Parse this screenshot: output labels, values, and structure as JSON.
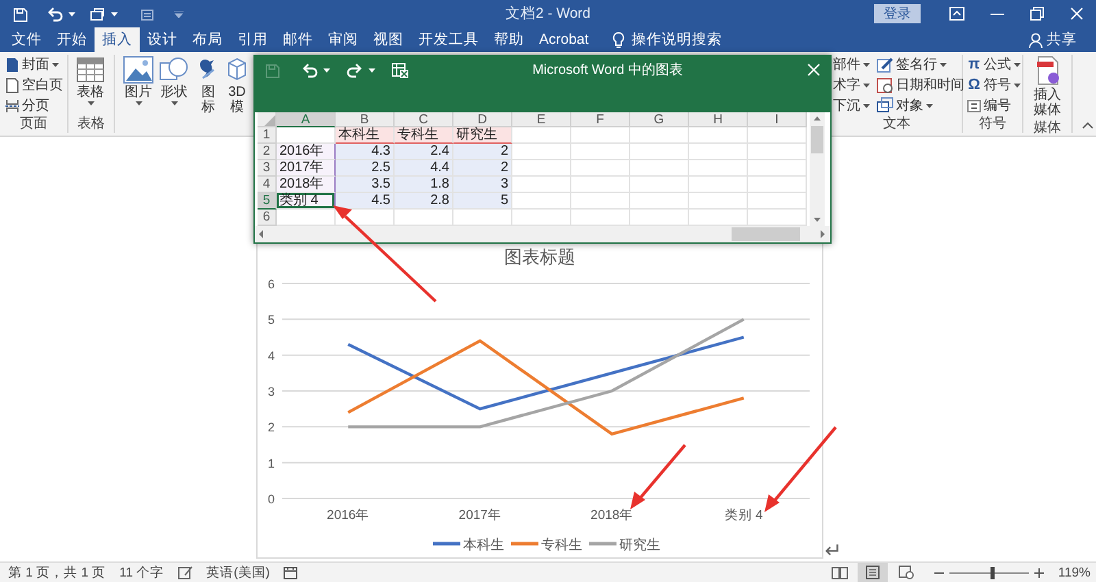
{
  "title_bar": {
    "title": "文档2 - Word",
    "sign_in": "登录"
  },
  "tabs": [
    {
      "label": "文件",
      "selected": false
    },
    {
      "label": "开始",
      "selected": false
    },
    {
      "label": "插入",
      "selected": true
    },
    {
      "label": "设计",
      "selected": false
    },
    {
      "label": "布局",
      "selected": false
    },
    {
      "label": "引用",
      "selected": false
    },
    {
      "label": "邮件",
      "selected": false
    },
    {
      "label": "审阅",
      "selected": false
    },
    {
      "label": "视图",
      "selected": false
    },
    {
      "label": "开发工具",
      "selected": false
    },
    {
      "label": "帮助",
      "selected": false
    },
    {
      "label": "Acrobat",
      "selected": false
    }
  ],
  "tell_me": "操作说明搜索",
  "share": "共享",
  "ribbon": {
    "pages": {
      "label": "页面",
      "items": [
        {
          "label": "封面",
          "dropdown": true
        },
        {
          "label": "空白页",
          "dropdown": false
        },
        {
          "label": "分页",
          "dropdown": false
        }
      ]
    },
    "tables": {
      "label": "表格",
      "button": {
        "lines": [
          "表格"
        ],
        "dropdown": true
      }
    },
    "illustrations": [
      {
        "lines": [
          "图片"
        ],
        "dropdown": true
      },
      {
        "lines": [
          "形状"
        ],
        "dropdown": true
      },
      {
        "lines": [
          "图",
          "标"
        ],
        "dropdown": false
      },
      {
        "lines": [
          "3D",
          "模"
        ],
        "dropdown": false
      }
    ],
    "text": {
      "label": "文本",
      "columns": [
        [
          {
            "label": "部件",
            "dropdown": true
          },
          {
            "label": "术字",
            "dropdown": true
          },
          {
            "label": "下沉",
            "dropdown": true
          }
        ],
        [
          {
            "label": "签名行",
            "dropdown": true
          },
          {
            "label": "日期和时间",
            "dropdown": false
          },
          {
            "label": "对象",
            "dropdown": true
          }
        ]
      ]
    },
    "symbols": {
      "label": "符号",
      "items": [
        {
          "symbol": "π",
          "label": "公式",
          "dropdown": true
        },
        {
          "symbol": "Ω",
          "label": "符号",
          "dropdown": true
        },
        {
          "label": "编号",
          "dropdown": false
        }
      ]
    },
    "media": {
      "label": "媒体",
      "button": {
        "lines": [
          "插入",
          "媒体"
        ],
        "dropdown": false
      }
    }
  },
  "chart_window": {
    "title": "Microsoft Word 中的图表",
    "columns": [
      "A",
      "B",
      "C",
      "D",
      "E",
      "F",
      "G",
      "H",
      "I"
    ],
    "rows": [
      {
        "header": "1",
        "cells": [
          {
            "kind": "blank",
            "selected": false
          },
          {
            "kind": "series",
            "text": "本科生",
            "selected": false
          },
          {
            "kind": "series",
            "text": "专科生",
            "selected": false
          },
          {
            "kind": "series",
            "text": "研究生",
            "selected": false
          }
        ]
      },
      {
        "header": "2",
        "cells": [
          {
            "kind": "category",
            "text": "2016年",
            "selected": false
          },
          {
            "kind": "value",
            "text": "4.3",
            "selected": false
          },
          {
            "kind": "value",
            "text": "2.4",
            "selected": false
          },
          {
            "kind": "value",
            "text": "2",
            "selected": false
          }
        ]
      },
      {
        "header": "3",
        "cells": [
          {
            "kind": "category",
            "text": "2017年",
            "selected": false
          },
          {
            "kind": "value",
            "text": "2.5",
            "selected": false
          },
          {
            "kind": "value",
            "text": "4.4",
            "selected": false
          },
          {
            "kind": "value",
            "text": "2",
            "selected": false
          }
        ]
      },
      {
        "header": "4",
        "cells": [
          {
            "kind": "category",
            "text": "2018年",
            "selected": false
          },
          {
            "kind": "value",
            "text": "3.5",
            "selected": false
          },
          {
            "kind": "value",
            "text": "1.8",
            "selected": false
          },
          {
            "kind": "value",
            "text": "3",
            "selected": false
          }
        ]
      },
      {
        "header": "5",
        "cells": [
          {
            "kind": "category",
            "text": "类别 4",
            "selected": true
          },
          {
            "kind": "value",
            "text": "4.5",
            "selected": false
          },
          {
            "kind": "value",
            "text": "2.8",
            "selected": false
          },
          {
            "kind": "value",
            "text": "5",
            "selected": false
          }
        ]
      },
      {
        "header": "6",
        "cells": []
      }
    ]
  },
  "chart": {
    "chart_data": {
      "type": "line",
      "title": "图表标题",
      "categories": [
        "2016年",
        "2017年",
        "2018年",
        "类别 4"
      ],
      "series": [
        {
          "name": "本科生",
          "color": "#4472c4",
          "values": [
            4.3,
            2.5,
            3.5,
            4.5
          ]
        },
        {
          "name": "专科生",
          "color": "#ed7d31",
          "values": [
            2.4,
            4.4,
            1.8,
            2.8
          ]
        },
        {
          "name": "研究生",
          "color": "#a5a5a5",
          "values": [
            2,
            2,
            3,
            5
          ]
        }
      ],
      "ylim": [
        0,
        6
      ],
      "yticks": [
        0,
        1,
        2,
        3,
        4,
        5,
        6
      ],
      "grid": true,
      "legend": "bottom"
    }
  },
  "paragraph_mark": "↵",
  "status_bar": {
    "page": "第 1 页，共 1 页",
    "words": "11 个字",
    "language": "英语(美国)",
    "views": [
      {
        "selected": false
      },
      {
        "selected": true
      },
      {
        "selected": false
      }
    ],
    "zoom": {
      "level": 0.53,
      "reading": "119%"
    }
  }
}
